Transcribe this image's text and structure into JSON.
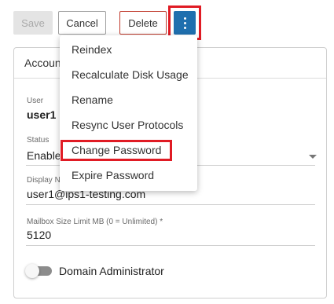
{
  "toolbar": {
    "save_label": "Save",
    "cancel_label": "Cancel",
    "delete_label": "Delete",
    "more_icon": "vertical-ellipsis-icon"
  },
  "card": {
    "title": "Account"
  },
  "fields": {
    "user": {
      "label": "User",
      "value": "user1"
    },
    "status": {
      "label": "Status",
      "value": "Enabled"
    },
    "display_name": {
      "label": "Display Name",
      "value": "user1@ips1-testing.com"
    },
    "mailbox_limit": {
      "label": "Mailbox Size Limit MB (0 = Unlimited) *",
      "value": "5120"
    }
  },
  "toggle": {
    "label": "Domain Administrator",
    "on": false
  },
  "menu": {
    "items": [
      {
        "label": "Reindex"
      },
      {
        "label": "Recalculate Disk Usage"
      },
      {
        "label": "Rename"
      },
      {
        "label": "Resync User Protocols"
      },
      {
        "label": "Change Password"
      },
      {
        "label": "Expire Password"
      }
    ]
  },
  "colors": {
    "primary": "#1f6fae",
    "danger": "#c0392b",
    "highlight": "#e01b24"
  }
}
